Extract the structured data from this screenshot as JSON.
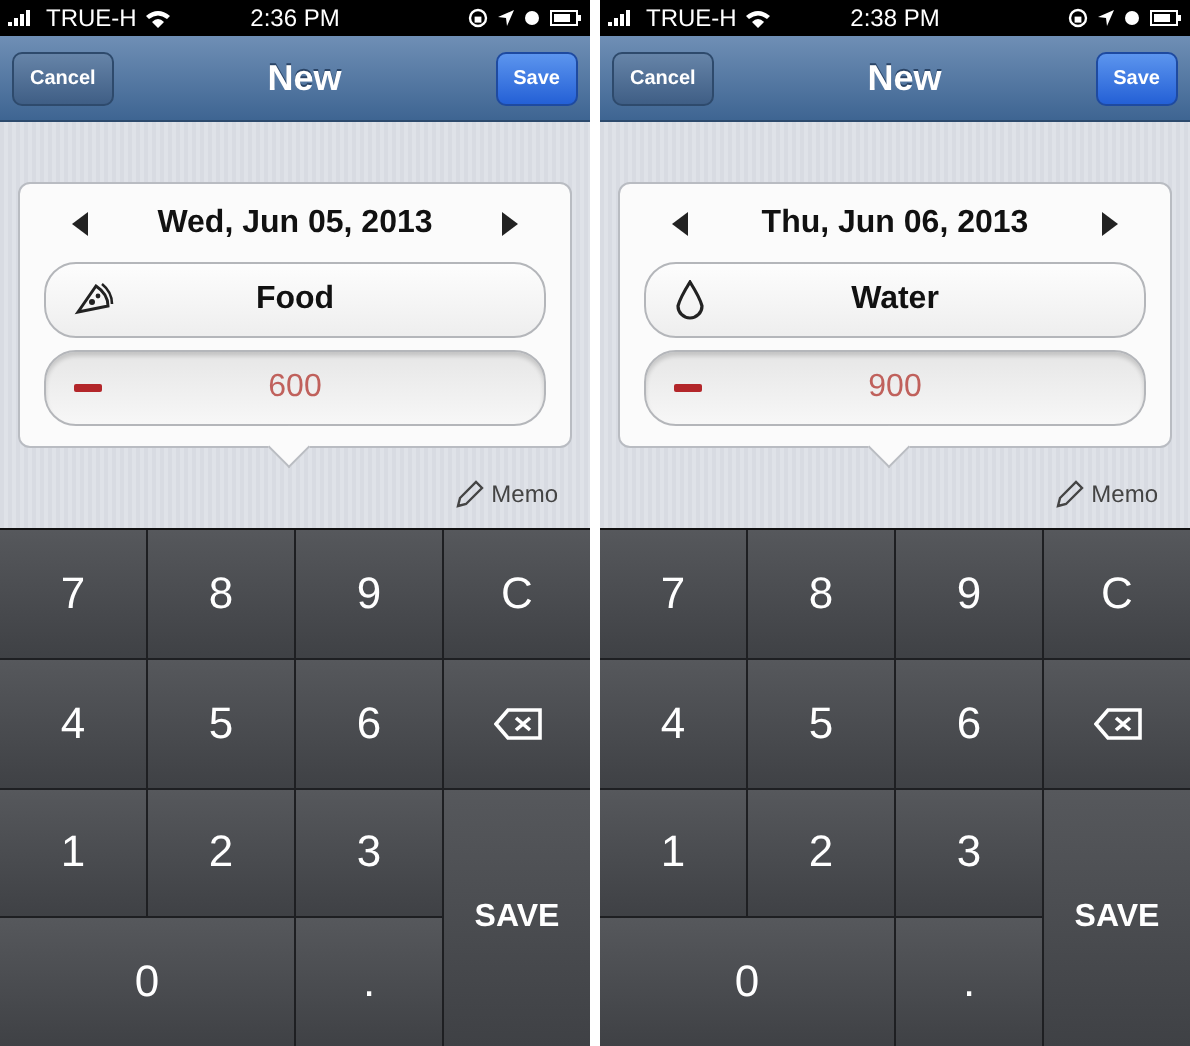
{
  "screens": [
    {
      "status_bar": {
        "carrier": "TRUE-H",
        "time": "2:36 PM"
      },
      "nav": {
        "cancel": "Cancel",
        "title": "New",
        "save": "Save"
      },
      "date": "Wed, Jun 05, 2013",
      "category": {
        "kind": "food",
        "label": "Food"
      },
      "amount": "600",
      "memo": "Memo",
      "keys": [
        {
          "kind": "key",
          "label": "7"
        },
        {
          "kind": "key",
          "label": "8"
        },
        {
          "kind": "key",
          "label": "9"
        },
        {
          "kind": "key",
          "label": "C"
        },
        {
          "kind": "key",
          "label": "4"
        },
        {
          "kind": "key",
          "label": "5"
        },
        {
          "kind": "key",
          "label": "6"
        },
        {
          "kind": "backspace"
        },
        {
          "kind": "key",
          "label": "1"
        },
        {
          "kind": "key",
          "label": "2"
        },
        {
          "kind": "key",
          "label": "3"
        },
        {
          "kind": "tall",
          "label": "SAVE"
        },
        {
          "kind": "wide",
          "label": "0"
        },
        {
          "kind": "key",
          "label": "."
        }
      ]
    },
    {
      "status_bar": {
        "carrier": "TRUE-H",
        "time": "2:38 PM"
      },
      "nav": {
        "cancel": "Cancel",
        "title": "New",
        "save": "Save"
      },
      "date": "Thu, Jun 06, 2013",
      "category": {
        "kind": "water",
        "label": "Water"
      },
      "amount": "900",
      "memo": "Memo",
      "keys": [
        {
          "kind": "key",
          "label": "7"
        },
        {
          "kind": "key",
          "label": "8"
        },
        {
          "kind": "key",
          "label": "9"
        },
        {
          "kind": "key",
          "label": "C"
        },
        {
          "kind": "key",
          "label": "4"
        },
        {
          "kind": "key",
          "label": "5"
        },
        {
          "kind": "key",
          "label": "6"
        },
        {
          "kind": "backspace"
        },
        {
          "kind": "key",
          "label": "1"
        },
        {
          "kind": "key",
          "label": "2"
        },
        {
          "kind": "key",
          "label": "3"
        },
        {
          "kind": "tall",
          "label": "SAVE"
        },
        {
          "kind": "wide",
          "label": "0"
        },
        {
          "kind": "key",
          "label": "."
        }
      ]
    }
  ]
}
